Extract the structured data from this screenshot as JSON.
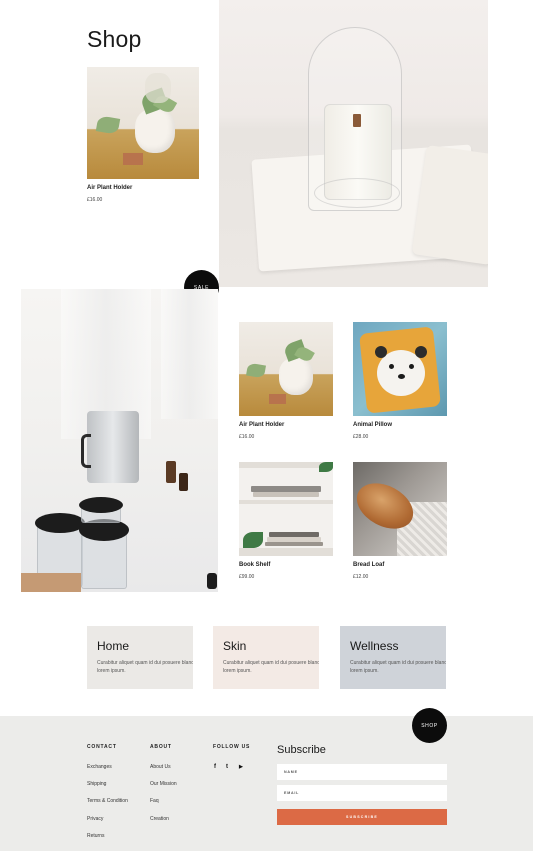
{
  "shop": {
    "title": "Shop"
  },
  "featured": {
    "name": "Air Plant Holder",
    "price": "£16.00"
  },
  "sale_badge": "SALE",
  "products": [
    {
      "name": "Air Plant Holder",
      "price": "£16.00",
      "image": "air-plant"
    },
    {
      "name": "Animal Pillow",
      "price": "£28.00",
      "image": "animal-pillow"
    },
    {
      "name": "Book Shelf",
      "price": "£99.00",
      "image": "book-shelf"
    },
    {
      "name": "Bread Loaf",
      "price": "£12.00",
      "image": "bread-loaf"
    }
  ],
  "categories": [
    {
      "title": "Home",
      "desc": "Curabitur aliquet quam id dui posuere blandit lorem ipsum.",
      "bg": "#ebe9e6"
    },
    {
      "title": "Skin",
      "desc": "Curabitur aliquet quam id dui posuere blandit lorem ipsum.",
      "bg": "#f3eae5"
    },
    {
      "title": "Wellness",
      "desc": "Curabitur aliquet quam id dui posuere blandit lorem ipsum.",
      "bg": "#cfd3d9"
    }
  ],
  "footer": {
    "shop_badge": "SHOP",
    "contact": {
      "heading": "CONTACT",
      "links": [
        "Exchanges",
        "Shipping",
        "Terms & Condition",
        "Privacy",
        "Returns"
      ]
    },
    "about": {
      "heading": "ABOUT",
      "links": [
        "About Us",
        "Our Mission",
        "Faq",
        "Creation"
      ]
    },
    "follow": {
      "heading": "FOLLOW US",
      "icons": [
        "facebook-icon",
        "twitter-icon",
        "youtube-icon"
      ],
      "glyphs": [
        "f",
        "t",
        "▶"
      ]
    },
    "subscribe": {
      "title": "Subscribe",
      "name_placeholder": "NAME",
      "email_placeholder": "EMAIL",
      "button": "SUBSCRIBE",
      "accent": "#dc6a45"
    }
  }
}
